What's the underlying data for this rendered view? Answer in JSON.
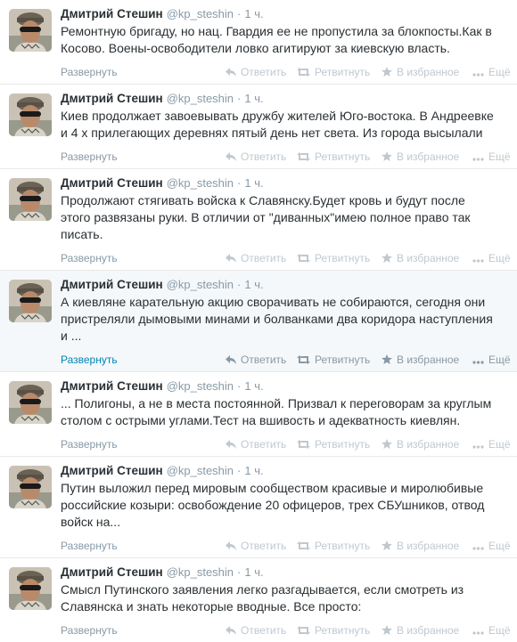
{
  "author": {
    "fullname": "Дмитрий Стешин",
    "username": "@kp_steshin",
    "dot": "·",
    "time": "1 ч."
  },
  "actions": {
    "expand": "Развернуть",
    "reply": "Ответить",
    "retweet": "Ретвитнуть",
    "favorite": "В избранное",
    "more": "Ещё"
  },
  "icons": {
    "reply": "reply-arrow-icon",
    "retweet": "retweet-icon",
    "favorite": "star-icon",
    "more": "ellipsis-icon"
  },
  "colors": {
    "link": "#0084b4",
    "muted": "#8899a6",
    "text": "#292f33"
  },
  "tweets": [
    {
      "text": "Ремонтную бригаду, но нац. Гвардия ее не пропустила за блокпосты.Как в\nКосово. Воены-освободители ловко  агитируют за киевскую власть."
    },
    {
      "text": "Киев продолжает завоевывать дружбу жителей Юго-востока. В Андреевке\nи 4 х прилегающих деревнях пятый день нет света. Из города высылали"
    },
    {
      "text": "Продолжают стягивать войска к Славянску.Будет кровь и будут после\nэтого развязаны руки. В отличии от \"диванных\"имею полное право так\nписать."
    },
    {
      "text": "А киевляне карательную акцию сворачивать не собираются, сегодня они\nпристреляли дымовыми минами и болванками два коридора наступления\nи ..."
    },
    {
      "text": "... Полигоны, а не в места постоянной. Призвал к переговорам за круглым\nстолом с острыми углами.Тест на вшивость и адекватность киевлян."
    },
    {
      "text": "Путин выложил перед мировым сообществом красивые и миролюбивые\nроссийские козыри: освобождение 20 офицеров, трех СБУшников, отвод\nвойск на..."
    },
    {
      "text": "Смысл Путинского заявления легко разгадывается, если смотреть из\nСлавянска и знать некоторые вводные. Все просто:"
    }
  ]
}
